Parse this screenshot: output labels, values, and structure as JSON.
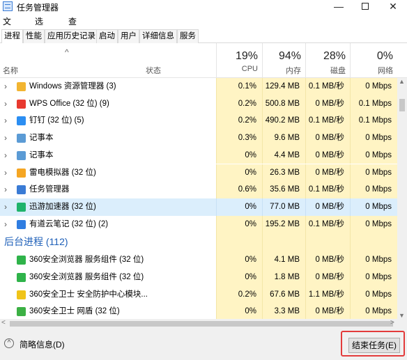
{
  "window": {
    "title": "任务管理器"
  },
  "menu": [
    "文件(F)",
    "选项(O)",
    "查看(V)"
  ],
  "tabs": [
    "进程",
    "性能",
    "应用历史记录",
    "启动",
    "用户",
    "详细信息",
    "服务"
  ],
  "columns": {
    "name": "名称",
    "status": "状态",
    "cpu": {
      "pct": "19%",
      "label": "CPU"
    },
    "mem": {
      "pct": "94%",
      "label": "内存"
    },
    "disk": {
      "pct": "28%",
      "label": "磁盘"
    },
    "net": {
      "pct": "0%",
      "label": "网络"
    }
  },
  "apps": [
    {
      "name": "Windows 资源管理器 (3)",
      "icon": "folder-icon",
      "color": "#f2b531",
      "cpu": "0.1%",
      "mem": "129.4 MB",
      "disk": "0.1 MB/秒",
      "net": "0 Mbps"
    },
    {
      "name": "WPS Office (32 位) (9)",
      "icon": "wps-icon",
      "color": "#e8392f",
      "cpu": "0.2%",
      "mem": "500.8 MB",
      "disk": "0 MB/秒",
      "net": "0.1 Mbps"
    },
    {
      "name": "钉钉 (32 位) (5)",
      "icon": "dingtalk-icon",
      "color": "#2b8ef2",
      "cpu": "0.2%",
      "mem": "490.2 MB",
      "disk": "0.1 MB/秒",
      "net": "0.1 Mbps"
    },
    {
      "name": "记事本",
      "icon": "notepad-icon",
      "color": "#5b9bd5",
      "cpu": "0.3%",
      "mem": "9.6 MB",
      "disk": "0 MB/秒",
      "net": "0 Mbps"
    },
    {
      "name": "记事本",
      "icon": "notepad-icon",
      "color": "#5b9bd5",
      "cpu": "0%",
      "mem": "4.4 MB",
      "disk": "0 MB/秒",
      "net": "0 Mbps"
    },
    {
      "name": "雷电模拟器 (32 位)",
      "icon": "ldplayer-icon",
      "color": "#f5a623",
      "cpu": "0%",
      "mem": "26.3 MB",
      "disk": "0 MB/秒",
      "net": "0 Mbps"
    },
    {
      "name": "任务管理器",
      "icon": "taskmgr-icon",
      "color": "#3a7bd5",
      "cpu": "0.6%",
      "mem": "35.6 MB",
      "disk": "0.1 MB/秒",
      "net": "0 Mbps"
    },
    {
      "name": "迅游加速器 (32 位)",
      "icon": "xunyou-icon",
      "color": "#1fb36b",
      "cpu": "0%",
      "mem": "77.0 MB",
      "disk": "0 MB/秒",
      "net": "0 Mbps",
      "selected": true
    },
    {
      "name": "有道云笔记 (32 位) (2)",
      "icon": "youdao-icon",
      "color": "#2f7de1",
      "cpu": "0%",
      "mem": "195.2 MB",
      "disk": "0.1 MB/秒",
      "net": "0 Mbps"
    }
  ],
  "background_group": "后台进程 (112)",
  "background": [
    {
      "name": "360安全浏览器 服务组件 (32 位)",
      "icon": "360browser-icon",
      "color": "#2fb34a",
      "cpu": "0%",
      "mem": "4.1 MB",
      "disk": "0 MB/秒",
      "net": "0 Mbps"
    },
    {
      "name": "360安全浏览器 服务组件 (32 位)",
      "icon": "360browser-icon",
      "color": "#2fb34a",
      "cpu": "0%",
      "mem": "1.8 MB",
      "disk": "0 MB/秒",
      "net": "0 Mbps"
    },
    {
      "name": "360安全卫士 安全防护中心模块...",
      "icon": "360safe-icon",
      "color": "#f0c419",
      "cpu": "0.2%",
      "mem": "67.6 MB",
      "disk": "1.1 MB/秒",
      "net": "0 Mbps"
    },
    {
      "name": "360安全卫士 网盾 (32 位)",
      "icon": "360shield-icon",
      "color": "#3cb044",
      "cpu": "0%",
      "mem": "3.3 MB",
      "disk": "0 MB/秒",
      "net": "0 Mbps"
    }
  ],
  "footer": {
    "fewer_details": "简略信息(D)",
    "end_task": "结束任务(E)"
  }
}
